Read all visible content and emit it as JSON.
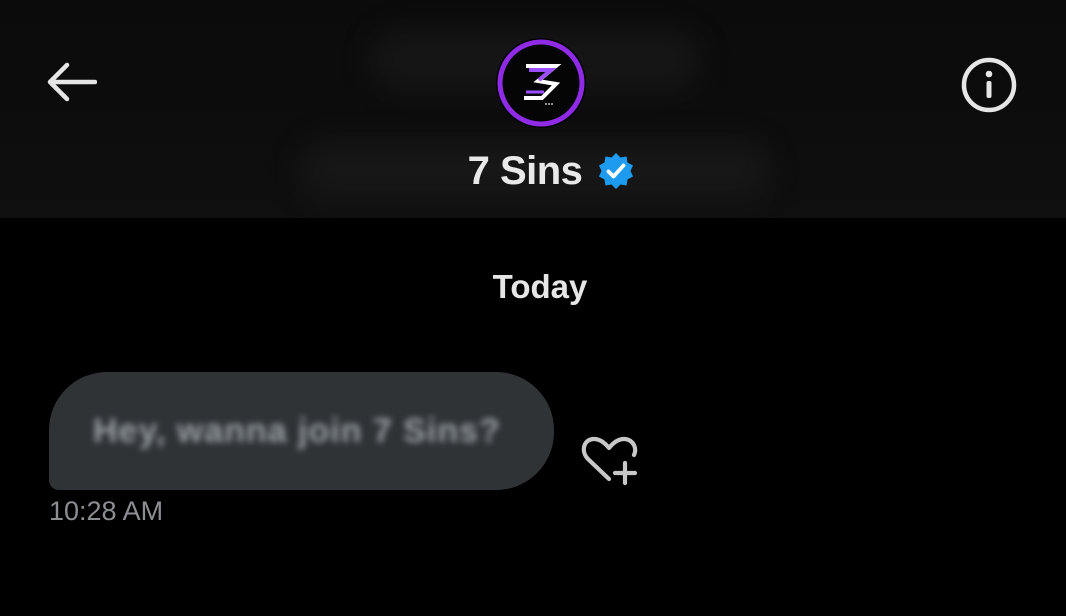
{
  "header": {
    "back_icon": "arrow-left-icon",
    "avatar_icon": "7-sins-logo",
    "title": "7 Sins",
    "verified_icon": "verified-badge-icon",
    "info_icon": "info-circle-icon"
  },
  "conversation": {
    "date_separator": "Today",
    "messages": [
      {
        "text": "Hey, wanna join 7 Sins?",
        "time": "10:28 AM",
        "reaction_icon": "heart-plus-icon"
      }
    ]
  },
  "colors": {
    "background": "#000000",
    "header_background": "#0d0d0d",
    "bubble": "#2f3336",
    "verified_badge": "#1d9bf0",
    "avatar_ring": "#8f2be6"
  }
}
